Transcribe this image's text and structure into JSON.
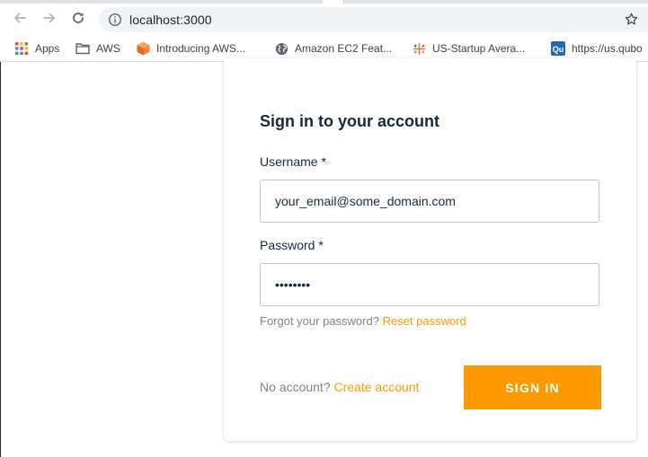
{
  "browser": {
    "url": "localhost:3000",
    "bookmarks": [
      {
        "label": "Apps",
        "icon": "apps-grid-icon"
      },
      {
        "label": "AWS",
        "icon": "folder-icon"
      },
      {
        "label": "Introducing AWS...",
        "icon": "aws-orange-cube-icon"
      },
      {
        "label": "Amazon EC2 Feat...",
        "icon": "globe-icon"
      },
      {
        "label": "US-Startup Avera...",
        "icon": "tableau-icon"
      },
      {
        "label": "https://us.qubo",
        "icon": "qubole-icon"
      }
    ]
  },
  "signin": {
    "title": "Sign in to your account",
    "username_label": "Username *",
    "username_value": "your_email@some_domain.com",
    "password_label": "Password *",
    "password_value": "12345678",
    "forgot_text": "Forgot your password?",
    "reset_link": "Reset password",
    "no_account_text": "No account?",
    "create_account_link": "Create account",
    "submit_label": "SIGN IN"
  },
  "colors": {
    "accent": "#ff9900",
    "heading": "#152939",
    "muted": "#828282"
  }
}
